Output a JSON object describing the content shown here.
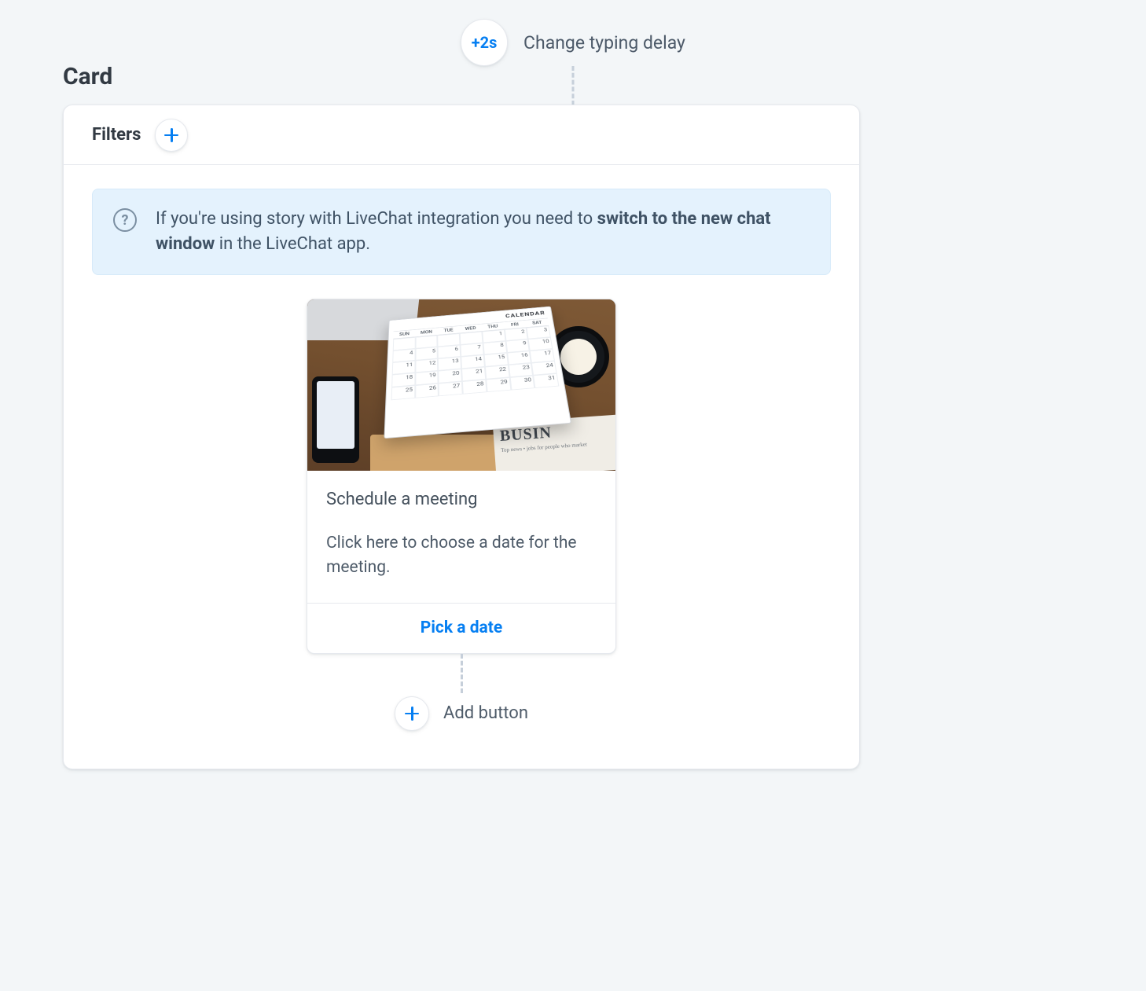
{
  "typing": {
    "badge": "+2s",
    "label": "Change typing delay"
  },
  "section": {
    "title": "Card"
  },
  "filters": {
    "label": "Filters"
  },
  "info": {
    "prefix": "If you're using story with LiveChat integration you need to ",
    "bold": "switch to the new chat window",
    "suffix": " in the LiveChat app."
  },
  "card": {
    "title": "Schedule a meeting",
    "description": "Click here to choose a date for the meeting.",
    "cta": "Pick a date",
    "image": {
      "calendar_label": "CALENDAR",
      "days_of_week": [
        "SUN",
        "MON",
        "TUE",
        "WED",
        "THU",
        "FRI",
        "SAT"
      ],
      "grid": [
        [
          "",
          "",
          "",
          "",
          "1",
          "2",
          "3"
        ],
        [
          "4",
          "5",
          "6",
          "7",
          "8",
          "9",
          "10"
        ],
        [
          "11",
          "12",
          "13",
          "14",
          "15",
          "16",
          "17"
        ],
        [
          "18",
          "19",
          "20",
          "21",
          "22",
          "23",
          "24"
        ],
        [
          "25",
          "26",
          "27",
          "28",
          "29",
          "30",
          "31"
        ]
      ],
      "newspaper_title": "BUSIN",
      "newspaper_sub": "Top news • jobs for people who market"
    }
  },
  "add_button": {
    "label": "Add button"
  }
}
